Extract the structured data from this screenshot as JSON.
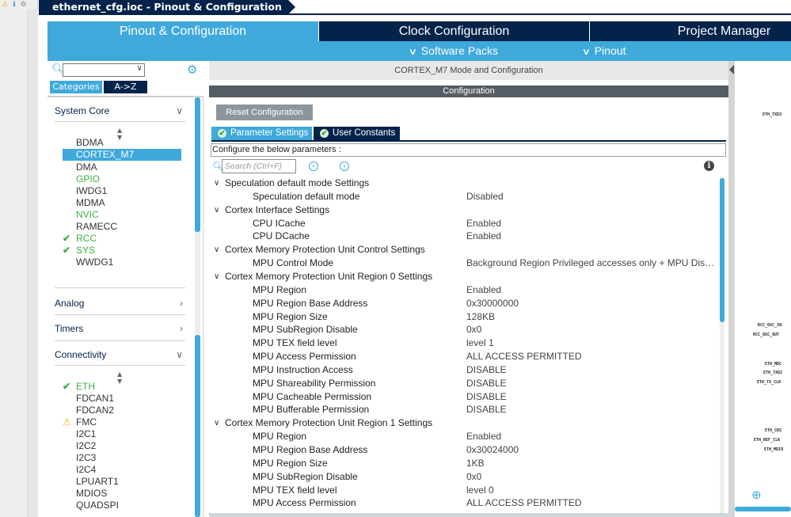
{
  "ide": {
    "toolbar_icons": [
      "warning-icon",
      "info-icon",
      "settings-icon"
    ]
  },
  "file_tab": {
    "title": "ethernet_cfg.ioc - Pinout & Configuration"
  },
  "main_tabs": [
    {
      "label": "Pinout & Configuration",
      "active": true
    },
    {
      "label": "Clock Configuration",
      "active": false
    },
    {
      "label": "Project Manager",
      "active": false
    }
  ],
  "sub_tabs": [
    {
      "label": "Software Packs",
      "icon": "chevron-down-icon"
    },
    {
      "label": "Pinout",
      "icon": "chevron-down-icon"
    }
  ],
  "left": {
    "search_value": "",
    "categories_label": "Categories",
    "az_label": "A->Z",
    "sections": [
      {
        "title": "System Core",
        "expanded": true,
        "items": [
          {
            "label": "BDMA",
            "state": "normal"
          },
          {
            "label": "CORTEX_M7",
            "state": "selected"
          },
          {
            "label": "DMA",
            "state": "normal"
          },
          {
            "label": "GPIO",
            "state": "green"
          },
          {
            "label": "IWDG1",
            "state": "normal"
          },
          {
            "label": "MDMA",
            "state": "normal"
          },
          {
            "label": "NVIC",
            "state": "green"
          },
          {
            "label": "RAMECC",
            "state": "normal"
          },
          {
            "label": "RCC",
            "state": "check"
          },
          {
            "label": "SYS",
            "state": "check"
          },
          {
            "label": "WWDG1",
            "state": "normal"
          }
        ]
      },
      {
        "title": "Analog",
        "expanded": false
      },
      {
        "title": "Timers",
        "expanded": false
      },
      {
        "title": "Connectivity",
        "expanded": true,
        "items": [
          {
            "label": "ETH",
            "state": "check"
          },
          {
            "label": "FDCAN1",
            "state": "normal"
          },
          {
            "label": "FDCAN2",
            "state": "normal"
          },
          {
            "label": "FMC",
            "state": "warning"
          },
          {
            "label": "I2C1",
            "state": "normal"
          },
          {
            "label": "I2C2",
            "state": "normal"
          },
          {
            "label": "I2C3",
            "state": "normal"
          },
          {
            "label": "I2C4",
            "state": "normal"
          },
          {
            "label": "LPUART1",
            "state": "normal"
          },
          {
            "label": "MDIOS",
            "state": "normal"
          },
          {
            "label": "QUADSPI",
            "state": "normal"
          }
        ]
      }
    ]
  },
  "center": {
    "mode_title": "CORTEX_M7 Mode and Configuration",
    "config_title": "Configuration",
    "reset_label": "Reset Configuration",
    "param_tabs": [
      {
        "label": "Parameter Settings",
        "active": true
      },
      {
        "label": "User Constants",
        "active": false
      }
    ],
    "params_hint": "Configure the below parameters :",
    "search_placeholder": "Search (Ctrl+F)",
    "tree": [
      {
        "type": "group",
        "label": "Speculation default mode Settings"
      },
      {
        "type": "param",
        "name": "Speculation default mode",
        "value": "Disabled"
      },
      {
        "type": "group",
        "label": "Cortex Interface Settings"
      },
      {
        "type": "param",
        "name": "CPU ICache",
        "value": "Enabled"
      },
      {
        "type": "param",
        "name": "CPU DCache",
        "value": "Enabled"
      },
      {
        "type": "group",
        "label": "Cortex Memory Protection Unit Control Settings"
      },
      {
        "type": "param",
        "name": "MPU Control Mode",
        "value": "Background Region Privileged accesses only + MPU Disabled ..."
      },
      {
        "type": "group",
        "label": "Cortex Memory Protection Unit Region 0 Settings"
      },
      {
        "type": "param",
        "name": "MPU Region",
        "value": "Enabled"
      },
      {
        "type": "param",
        "name": "MPU Region Base Address",
        "value": "0x30000000"
      },
      {
        "type": "param",
        "name": "MPU Region Size",
        "value": "128KB"
      },
      {
        "type": "param",
        "name": "MPU SubRegion Disable",
        "value": "0x0"
      },
      {
        "type": "param",
        "name": "MPU TEX field level",
        "value": "level 1"
      },
      {
        "type": "param",
        "name": "MPU Access Permission",
        "value": "ALL ACCESS PERMITTED"
      },
      {
        "type": "param",
        "name": "MPU Instruction Access",
        "value": "DISABLE"
      },
      {
        "type": "param",
        "name": "MPU Shareability Permission",
        "value": "DISABLE"
      },
      {
        "type": "param",
        "name": "MPU Cacheable Permission",
        "value": "DISABLE"
      },
      {
        "type": "param",
        "name": "MPU Bufferable  Permission",
        "value": "DISABLE"
      },
      {
        "type": "group",
        "label": "Cortex Memory Protection Unit Region 1 Settings"
      },
      {
        "type": "param",
        "name": "MPU Region",
        "value": "Enabled"
      },
      {
        "type": "param",
        "name": "MPU Region Base Address",
        "value": "0x30024000"
      },
      {
        "type": "param",
        "name": "MPU Region Size",
        "value": "1KB"
      },
      {
        "type": "param",
        "name": "MPU SubRegion Disable",
        "value": "0x0"
      },
      {
        "type": "param",
        "name": "MPU TEX field level",
        "value": "level 0"
      },
      {
        "type": "param",
        "name": "MPU Access Permission",
        "value": "ALL ACCESS PERMITTED"
      }
    ]
  },
  "pinout": {
    "pins": [
      "ETH_TXD3",
      "RCC_OSC_IN",
      "RCC_OSC_OUT",
      "ETH_MDC",
      "ETH_TXD2",
      "ETH_TX_CLK",
      "ETH_CRS",
      "ETH_REF_CLK",
      "ETH_MDIO"
    ]
  },
  "colors": {
    "navy": "#03234b",
    "accent": "#3fa9dc",
    "green": "#3cb043",
    "warning": "#f5b400"
  }
}
